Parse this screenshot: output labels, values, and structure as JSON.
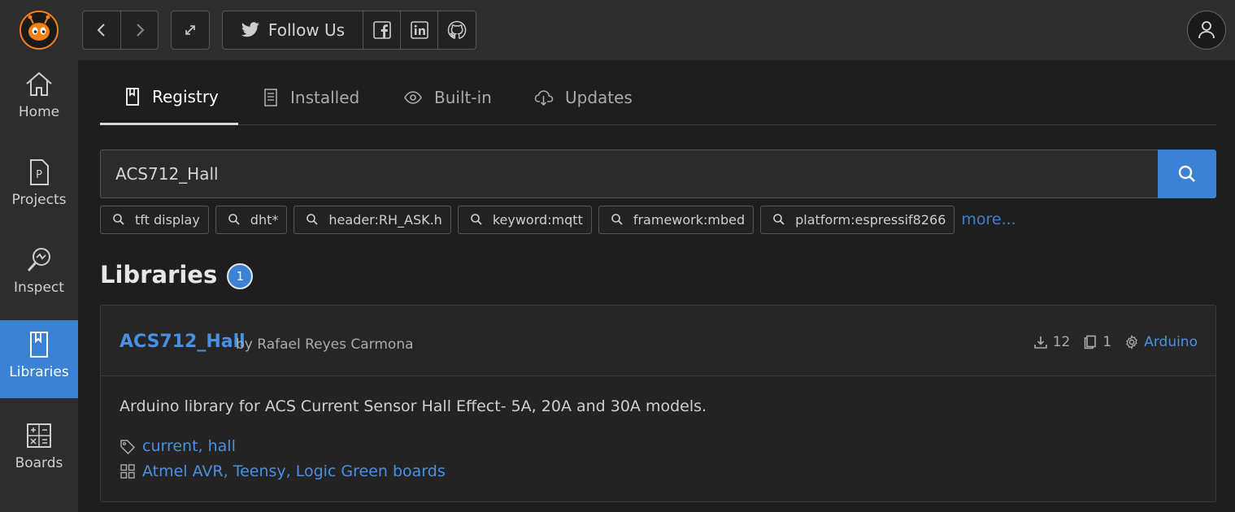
{
  "colors": {
    "accent": "#3b82d4",
    "link": "#4a90e2",
    "brand_orange": "#f08119"
  },
  "topbar": {
    "logo_icon": "platformio-alien-logo",
    "back_icon": "chevron-left-icon",
    "forward_icon": "chevron-right-icon",
    "expand_icon": "expand-icon",
    "follow_label": "Follow Us",
    "social_icons": [
      "twitter-icon",
      "facebook-icon",
      "linkedin-icon",
      "github-icon"
    ],
    "account_icon": "user-icon"
  },
  "sidebar": {
    "items": [
      {
        "label": "Home",
        "icon": "home-icon"
      },
      {
        "label": "Projects",
        "icon": "projects-icon"
      },
      {
        "label": "Inspect",
        "icon": "inspect-icon"
      },
      {
        "label": "Libraries",
        "icon": "libraries-icon",
        "active": true
      },
      {
        "label": "Boards",
        "icon": "boards-icon"
      }
    ]
  },
  "tabs": [
    {
      "label": "Registry",
      "icon": "book-icon",
      "active": true
    },
    {
      "label": "Installed",
      "icon": "list-icon"
    },
    {
      "label": "Built-in",
      "icon": "eye-icon"
    },
    {
      "label": "Updates",
      "icon": "cloud-download-icon"
    }
  ],
  "search": {
    "value": "ACS712_Hall",
    "placeholder": ""
  },
  "chips": [
    "tft display",
    "dht*",
    "header:RH_ASK.h",
    "keyword:mqtt",
    "framework:mbed",
    "platform:espressif8266"
  ],
  "more_label": "more...",
  "libraries": {
    "title": "Libraries",
    "count": "1",
    "items": [
      {
        "name": "ACS712_Hall",
        "by": "by Rafael Reyes Carmona",
        "downloads": "12",
        "examples": "1",
        "framework": "Arduino",
        "description": "Arduino library for ACS Current Sensor Hall Effect- 5A, 20A and 30A models.",
        "keywords": "current, hall",
        "platforms": "Atmel AVR, Teensy, Logic Green boards"
      }
    ]
  }
}
